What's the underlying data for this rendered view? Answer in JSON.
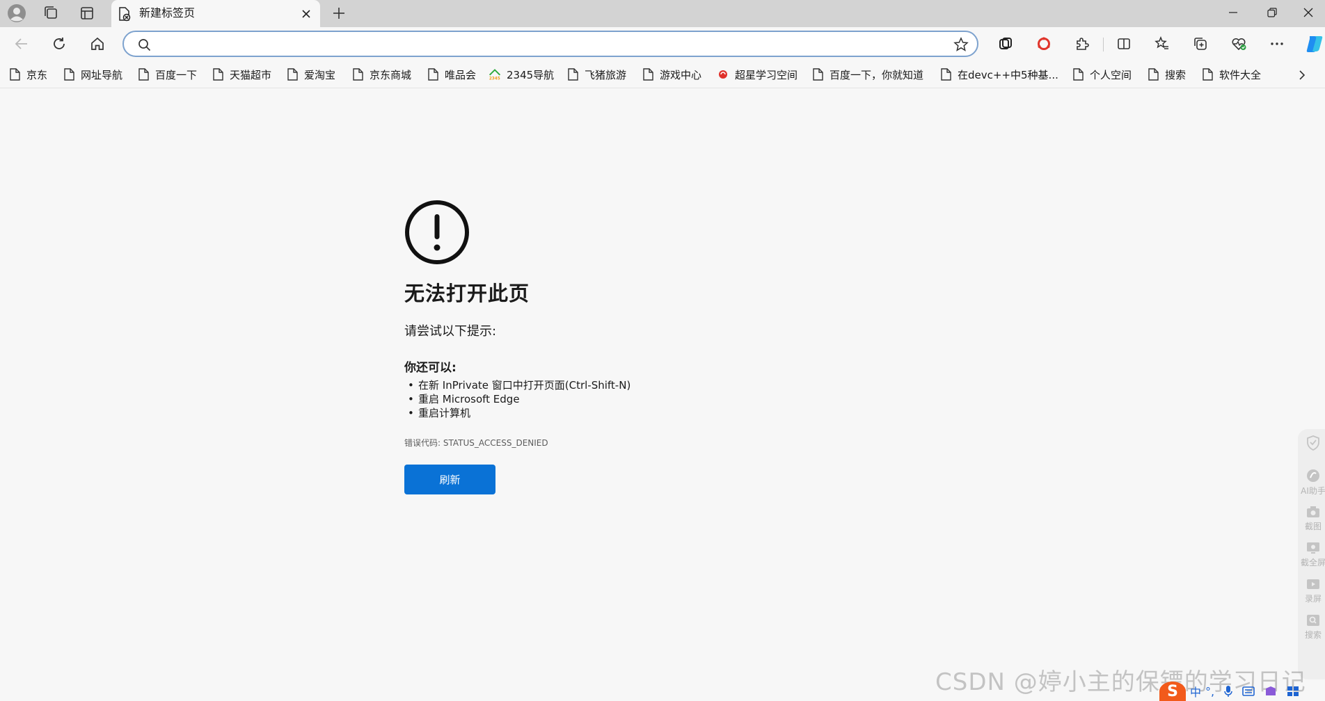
{
  "tab": {
    "title": "新建标签页"
  },
  "address": {
    "value": "",
    "placeholder": ""
  },
  "favorites": [
    {
      "label": "京东",
      "icon": "page-icon"
    },
    {
      "label": "网址导航",
      "icon": "page-icon"
    },
    {
      "label": "百度一下",
      "icon": "page-icon"
    },
    {
      "label": "天猫超市",
      "icon": "page-icon"
    },
    {
      "label": "爱淘宝",
      "icon": "page-icon"
    },
    {
      "label": "京东商城",
      "icon": "page-icon"
    },
    {
      "label": "唯品会",
      "icon": "page-icon"
    },
    {
      "label": "2345导航",
      "icon": "2345-logo-icon",
      "logo_text": "2345"
    },
    {
      "label": "飞猪旅游",
      "icon": "page-icon"
    },
    {
      "label": "游戏中心",
      "icon": "page-icon"
    },
    {
      "label": "超星学习空间",
      "icon": "chaoxing-logo-icon"
    },
    {
      "label": "百度一下，你就知道",
      "icon": "page-icon"
    },
    {
      "label": "在devc++中5种基...",
      "icon": "page-icon"
    },
    {
      "label": "个人空间",
      "icon": "page-icon"
    },
    {
      "label": "搜索",
      "icon": "page-icon"
    },
    {
      "label": "软件大全",
      "icon": "page-icon"
    }
  ],
  "error": {
    "title": "无法打开此页",
    "hint": "请尝试以下提示:",
    "subheading": "你还可以:",
    "suggestions": [
      "在新 InPrivate 窗口中打开页面(Ctrl-Shift-N)",
      "重启 Microsoft Edge",
      "重启计算机"
    ],
    "code_label": "错误代码:",
    "code_value": "STATUS_ACCESS_DENIED",
    "refresh_label": "刷新"
  },
  "side_panel": [
    {
      "label": "",
      "icon": "shield-icon"
    },
    {
      "label": "AI助手",
      "icon": "ai-assistant-icon"
    },
    {
      "label": "截图",
      "icon": "camera-icon"
    },
    {
      "label": "截全屏",
      "icon": "monitor-icon"
    },
    {
      "label": "录屏",
      "icon": "video-icon"
    },
    {
      "label": "搜索",
      "icon": "search-icon"
    }
  ],
  "watermark": "CSDN @婷小主的保镖的学习日记",
  "ime": {
    "logo": "S",
    "mode": "中",
    "punct": "°,"
  },
  "colors": {
    "accent": "#0a72d6",
    "tabstrip": "#d3d3d3",
    "background": "#f7f7f7",
    "copilot": "#1f8ef1"
  }
}
